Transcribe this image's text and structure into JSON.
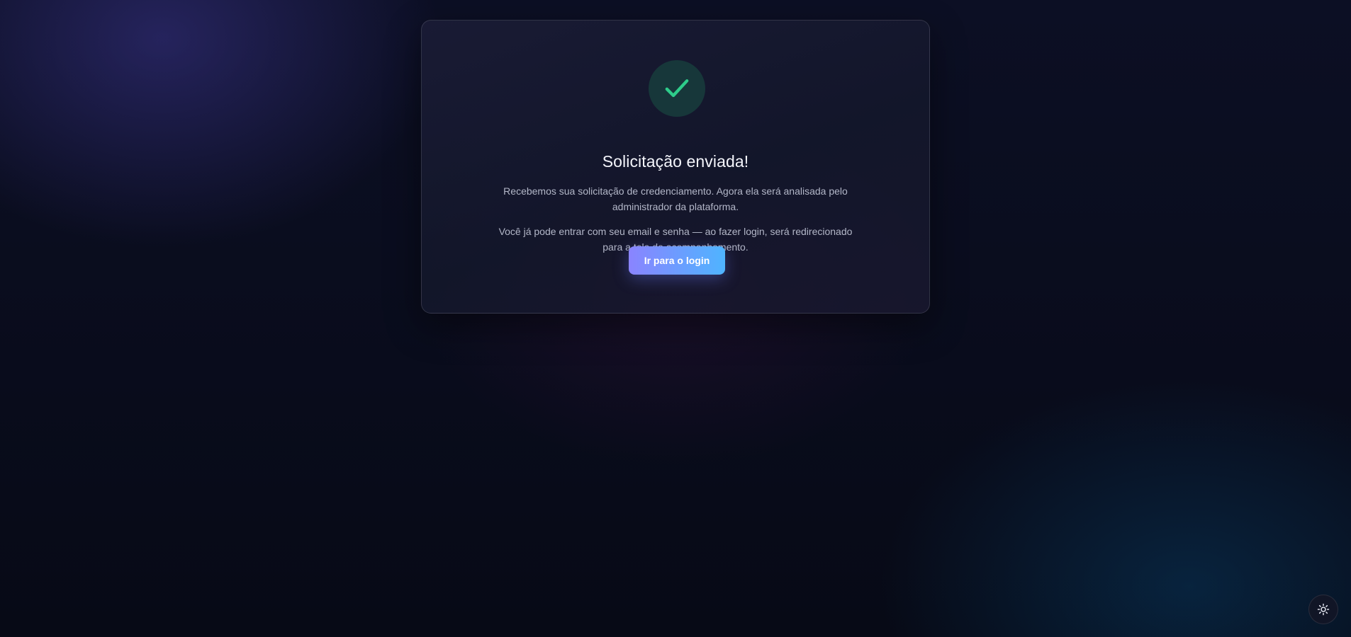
{
  "colors": {
    "success_accent": "#2ecc8a",
    "success_circle_bg": "#17373a",
    "button_gradient_start": "#8a84ff",
    "button_gradient_end": "#4fb4ff"
  },
  "success_card": {
    "icon": "check-icon",
    "title": "Solicitação enviada!",
    "paragraph_1": "Recebemos sua solicitação de credenciamento. Agora ela será analisada pelo administrador da plataforma.",
    "paragraph_2": "Você já pode entrar com seu email e senha — ao fazer login, será redirecionado para a tela de acompanhamento.",
    "button_label": "Ir para o login"
  },
  "theme_toggle": {
    "icon": "sun-icon"
  }
}
